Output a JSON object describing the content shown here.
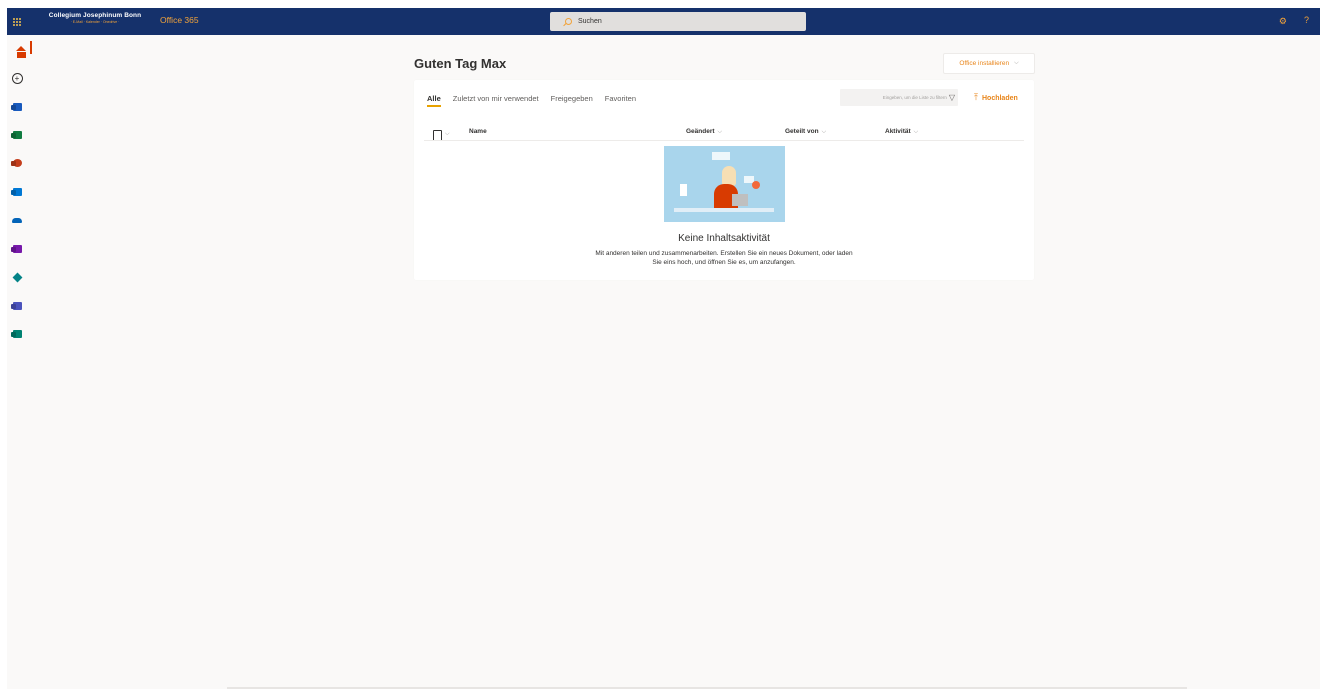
{
  "header": {
    "brand_title": "Collegium Josephinum Bonn",
    "brand_subtitle": "· E-Mail · Kalender · Onedrive ·",
    "product": "Office 365",
    "search_placeholder": "Suchen",
    "settings_icon": "gear-icon",
    "help_icon": "question-icon",
    "help_label": "?"
  },
  "rail": {
    "items": [
      {
        "name": "home",
        "icon": "home-icon"
      },
      {
        "name": "create",
        "icon": "plus-circle-icon"
      },
      {
        "name": "word",
        "icon": "word-icon",
        "color": "#185abd"
      },
      {
        "name": "excel",
        "icon": "excel-icon",
        "color": "#107c41"
      },
      {
        "name": "powerpoint",
        "icon": "powerpoint-icon",
        "color": "#c43e1c"
      },
      {
        "name": "outlook",
        "icon": "outlook-icon",
        "color": "#0078d4"
      },
      {
        "name": "onedrive",
        "icon": "onedrive-icon",
        "color": "#0364b8"
      },
      {
        "name": "onenote",
        "icon": "onenote-icon",
        "color": "#7719aa"
      },
      {
        "name": "sharepoint",
        "icon": "sharepoint-icon",
        "color": "#038387"
      },
      {
        "name": "teams",
        "icon": "teams-icon",
        "color": "#4b53bc"
      },
      {
        "name": "sway",
        "icon": "sway-icon",
        "color": "#008272"
      }
    ]
  },
  "main": {
    "greeting": "Guten Tag Max",
    "install_button": "Office installieren",
    "tabs": [
      {
        "label": "Alle",
        "active": true
      },
      {
        "label": "Zuletzt von mir verwendet",
        "active": false
      },
      {
        "label": "Freigegeben",
        "active": false
      },
      {
        "label": "Favoriten",
        "active": false
      }
    ],
    "filter_placeholder": "Eingeben, um die Liste zu filtern",
    "upload_label": "Hochladen",
    "columns": {
      "name": "Name",
      "changed": "Geändert",
      "shared_by": "Geteilt von",
      "activity": "Aktivität"
    },
    "empty_title": "Keine Inhaltsaktivität",
    "empty_description_line1": "Mit anderen teilen und zusammenarbeiten. Erstellen Sie ein neues Dokument, oder laden",
    "empty_description_line2": "Sie eins hoch, und öffnen Sie es, um anzufangen."
  },
  "colors": {
    "topbar": "#15316b",
    "accent": "#f2a33a",
    "home_active": "#d83b01"
  }
}
